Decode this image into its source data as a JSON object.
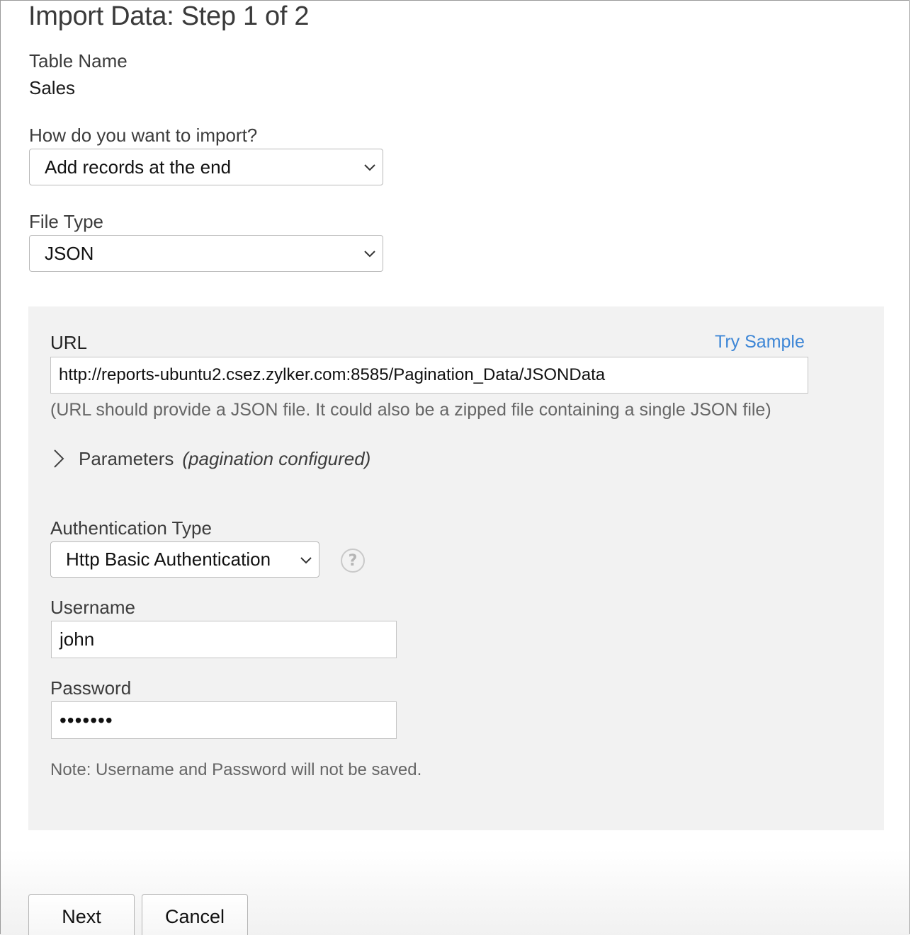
{
  "header": {
    "title": "Import Data: Step 1 of 2"
  },
  "table": {
    "label": "Table Name",
    "value": "Sales"
  },
  "import_mode": {
    "label": "How do you want to import?",
    "selected": "Add records at the end"
  },
  "file_type": {
    "label": "File Type",
    "selected": "JSON"
  },
  "url_section": {
    "label": "URL",
    "try_sample": "Try Sample",
    "value": "http://reports-ubuntu2.csez.zylker.com:8585/Pagination_Data/JSONData",
    "hint": "(URL should provide a JSON file. It could also be a zipped file containing a single JSON file)",
    "parameters_label": "Parameters",
    "parameters_note": "(pagination configured)"
  },
  "auth": {
    "label": "Authentication Type",
    "selected": "Http Basic Authentication",
    "help_symbol": "?",
    "username_label": "Username",
    "username_value": "john",
    "password_label": "Password",
    "password_masked": "•••••••",
    "note": "Note: Username and Password will not be saved."
  },
  "footer": {
    "next_label": "Next",
    "cancel_label": "Cancel"
  },
  "icons": {
    "dropdown": "chevron-down-icon",
    "expand": "chevron-right-icon",
    "help": "help-circle-icon"
  },
  "colors": {
    "link": "#3d86d6",
    "panel_bg": "#f2f2f2"
  }
}
